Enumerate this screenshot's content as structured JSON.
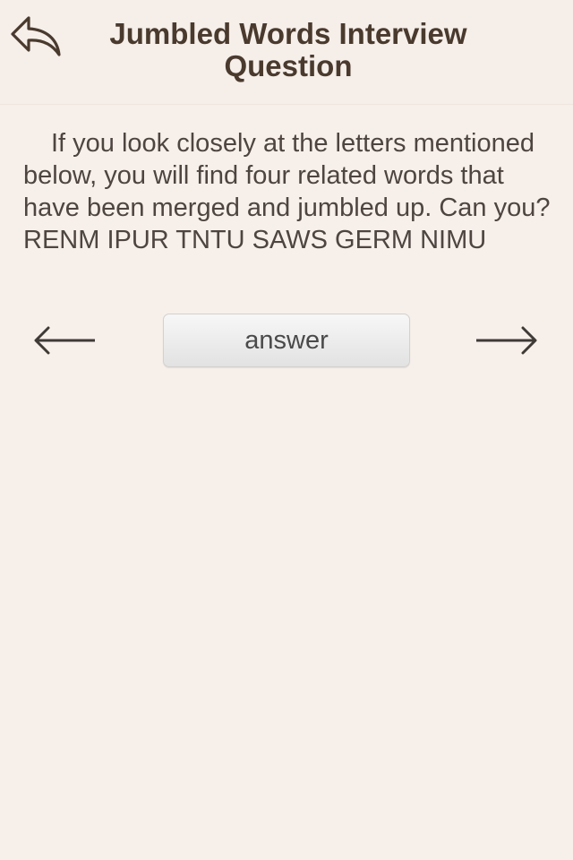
{
  "header": {
    "back_icon": "reply-back-icon",
    "title": "Jumbled Words Interview Question"
  },
  "content": {
    "question": "If you look closely at the letters mentioned below, you will find four related words that have been merged and jumbled up. Can you? RENM IPUR TNTU SAWS GERM NIMU"
  },
  "nav": {
    "prev_icon": "left-arrow-icon",
    "answer_label": "answer",
    "next_icon": "right-arrow-icon"
  },
  "colors": {
    "background": "#f6efea",
    "title": "#4a3a2e",
    "text": "#4e4540",
    "button": "#e9e9e9"
  }
}
